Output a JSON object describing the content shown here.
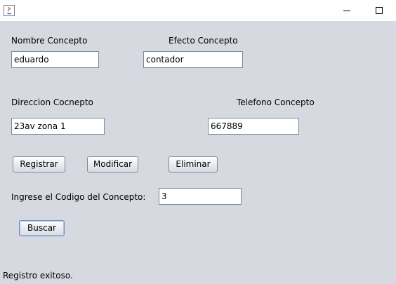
{
  "window": {
    "app_icon": "java-icon",
    "minimize_icon": "minimize-icon",
    "maximize_icon": "maximize-icon"
  },
  "form": {
    "nombre_label": "Nombre Concepto",
    "nombre_value": "eduardo",
    "efecto_label": "Efecto Concepto",
    "efecto_value": "contador",
    "direccion_label": "Direccion Cocnepto",
    "direccion_value": "23av zona 1",
    "telefono_label": "Telefono Concepto",
    "telefono_value": "667889"
  },
  "actions": {
    "registrar": "Registrar",
    "modificar": "Modificar",
    "eliminar": "Eliminar"
  },
  "search": {
    "codigo_label": "Ingrese el Codigo del Concepto:",
    "codigo_value": "3",
    "buscar": "Buscar"
  },
  "status": {
    "message": "Registro exitoso."
  }
}
